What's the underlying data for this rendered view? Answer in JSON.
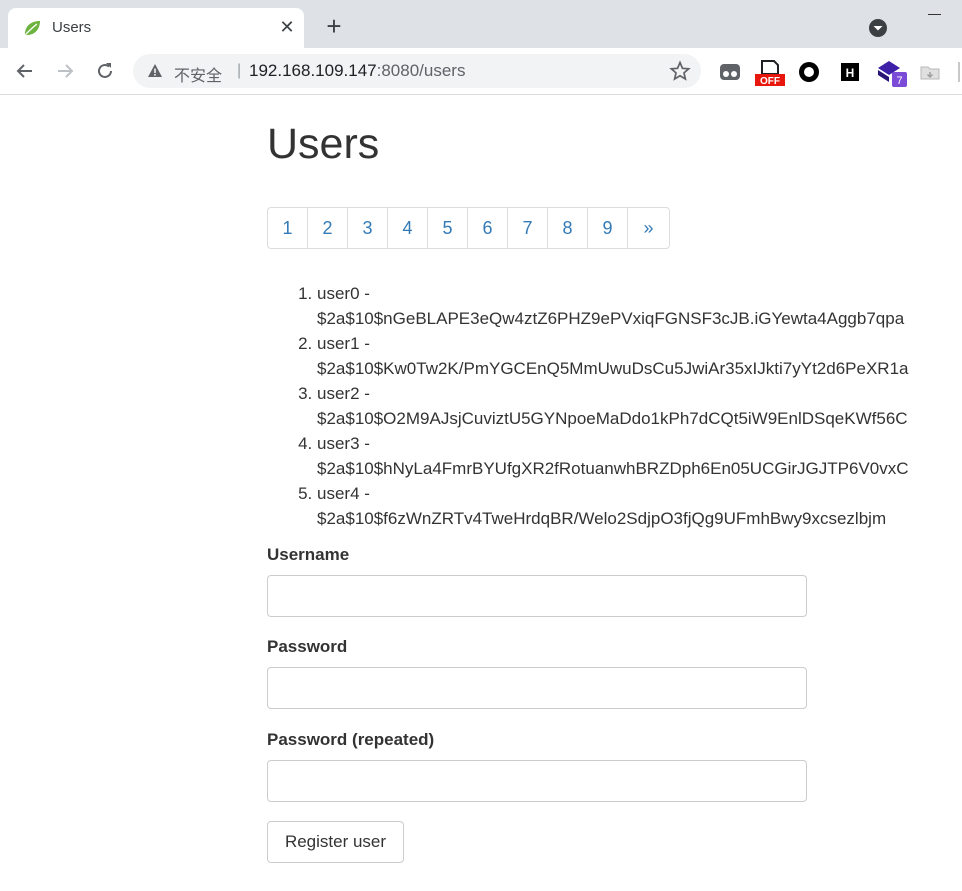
{
  "browser": {
    "tab": {
      "title": "Users",
      "close_glyph": "✕"
    },
    "new_tab_glyph": "+",
    "omnibox": {
      "security_label": "不安全",
      "separator": "|",
      "url_host": "192.168.109.147",
      "url_rest": ":8080/users"
    },
    "extensions": [
      {
        "name": "dots-extension-icon"
      },
      {
        "name": "off-extension-icon",
        "badge": "OFF"
      },
      {
        "name": "circle-extension-icon"
      },
      {
        "name": "h-extension-icon",
        "label": "H"
      },
      {
        "name": "gem-extension-icon",
        "badge": "7"
      },
      {
        "name": "folder-extension-icon"
      }
    ]
  },
  "page": {
    "title": "Users",
    "pagination": [
      "1",
      "2",
      "3",
      "4",
      "5",
      "6",
      "7",
      "8",
      "9",
      "»"
    ],
    "users": [
      {
        "name": "user0 -",
        "hash": "$2a$10$nGeBLAPE3eQw4ztZ6PHZ9ePVxiqFGNSF3cJB.iGYewta4Aggb7qpa"
      },
      {
        "name": "user1 -",
        "hash": "$2a$10$Kw0Tw2K/PmYGCEnQ5MmUwuDsCu5JwiAr35xIJkti7yYt2d6PeXR1a"
      },
      {
        "name": "user2 -",
        "hash": "$2a$10$O2M9AJsjCuviztU5GYNpoeMaDdo1kPh7dCQt5iW9EnlDSqeKWf56C"
      },
      {
        "name": "user3 -",
        "hash": "$2a$10$hNyLa4FmrBYUfgXR2fRotuanwhBRZDph6En05UCGirJGJTP6V0vxC"
      },
      {
        "name": "user4 -",
        "hash": "$2a$10$f6zWnZRTv4TweHrdqBR/Welo2SdjpO3fjQg9UFmhBwy9xcsezlbjm"
      }
    ],
    "form": {
      "username_label": "Username",
      "username_value": "",
      "password_label": "Password",
      "password_value": "",
      "password_repeat_label": "Password (repeated)",
      "password_repeat_value": "",
      "submit_label": "Register user"
    }
  },
  "colors": {
    "link": "#337ab7",
    "tabstrip": "#dee1e6",
    "text": "#333333"
  }
}
